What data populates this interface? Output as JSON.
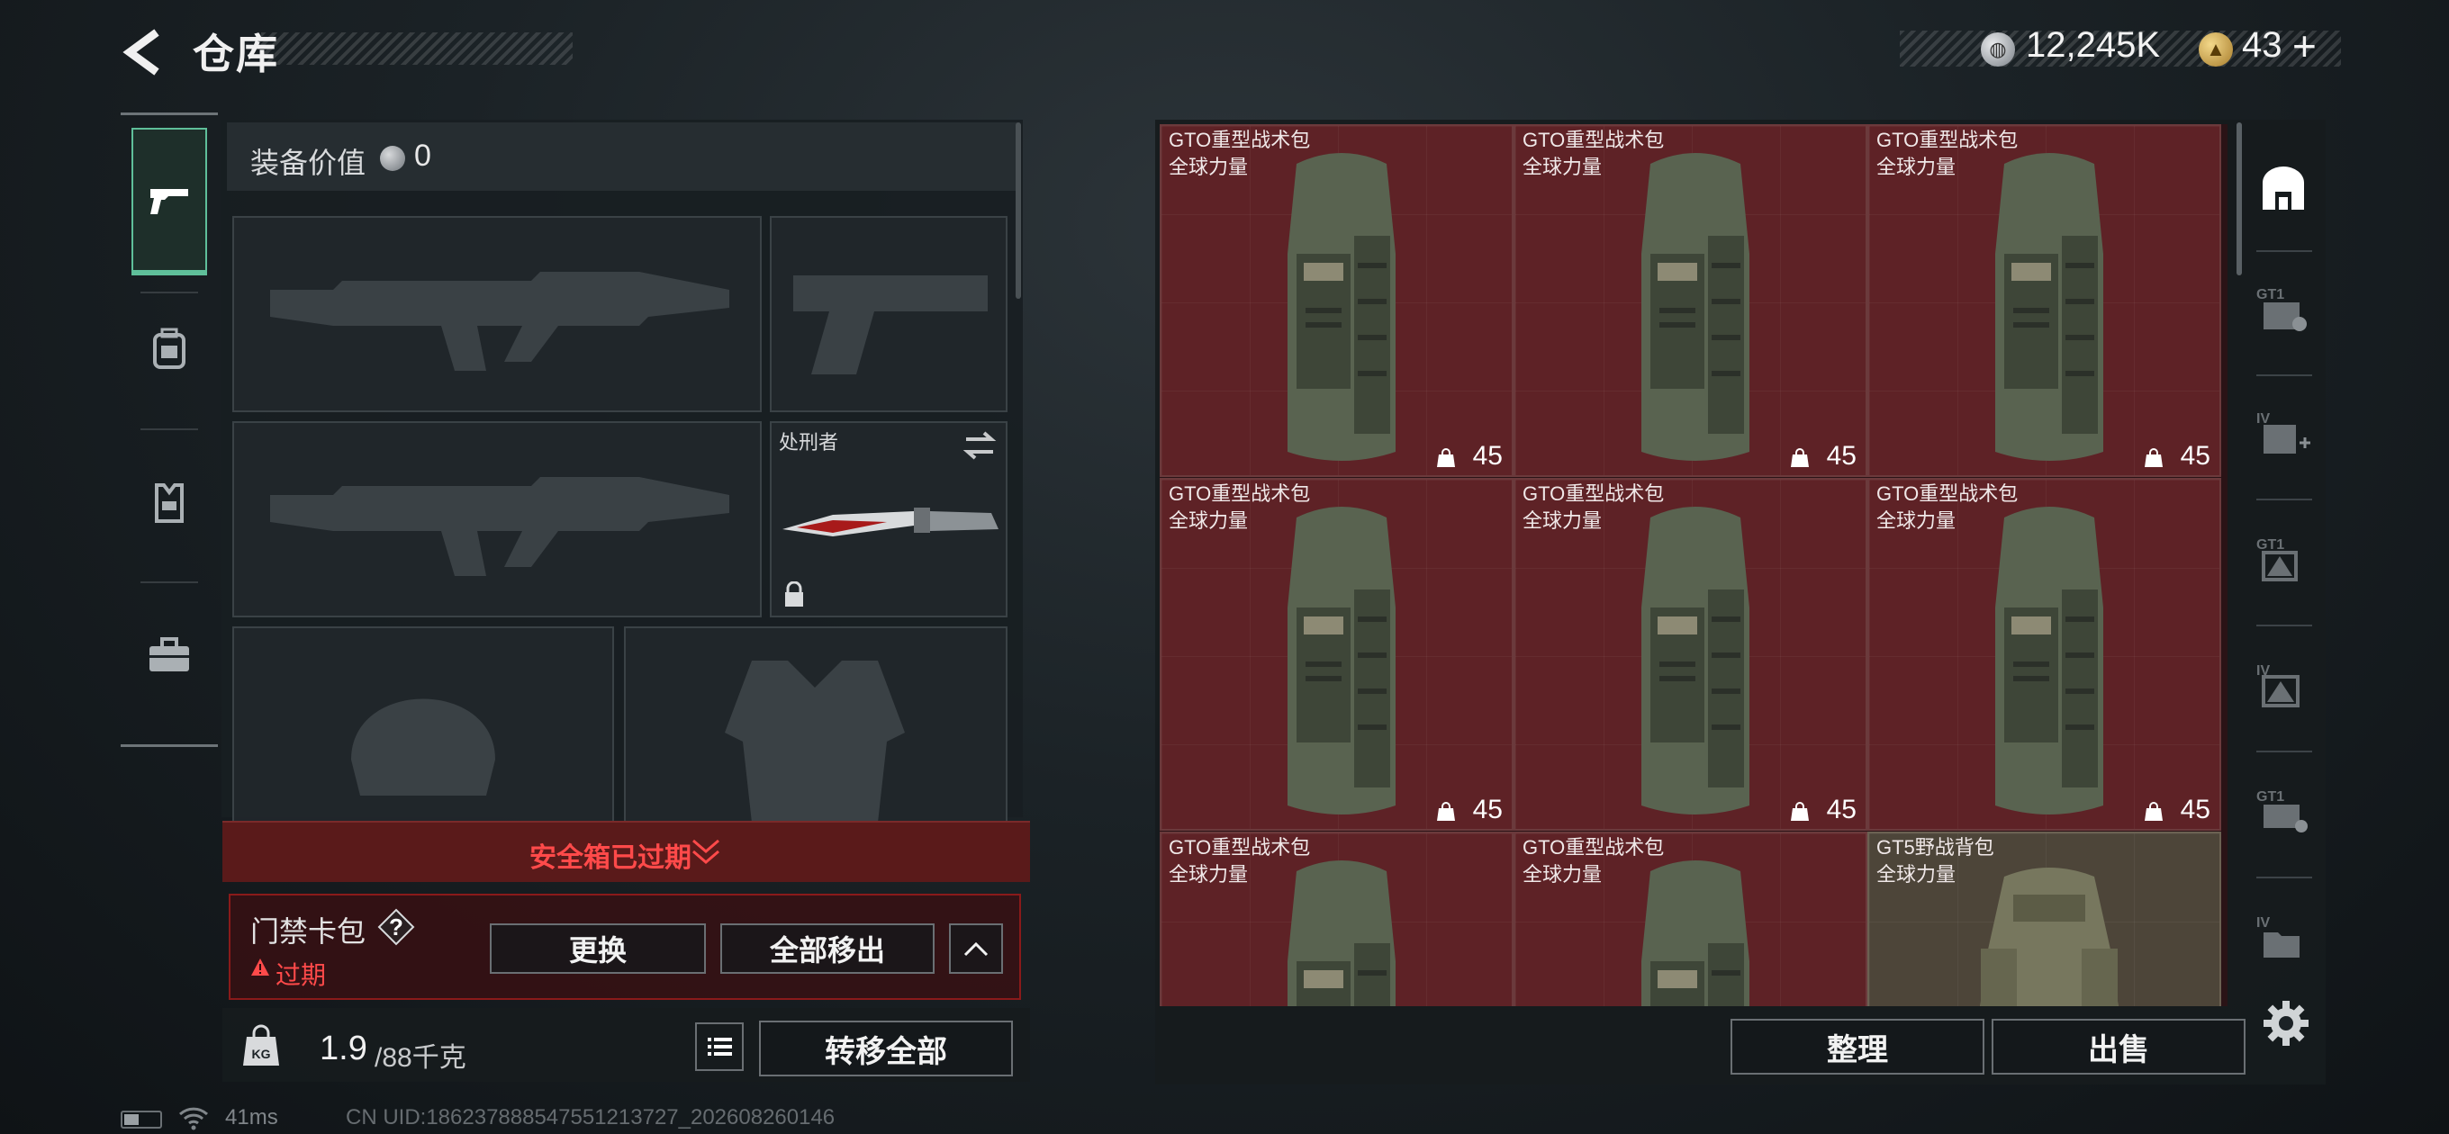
{
  "header": {
    "title": "仓库",
    "currency_primary": "12,245K",
    "currency_secondary": "43",
    "currency_add": "+"
  },
  "left_tabs": [
    {
      "icon": "pistol-icon",
      "active": true
    },
    {
      "icon": "backpack-icon",
      "active": false
    },
    {
      "icon": "vest-icon",
      "active": false
    },
    {
      "icon": "briefcase-icon",
      "active": false
    }
  ],
  "equipment": {
    "value_label": "装备价值",
    "value": "0",
    "melee_name": "处刑者",
    "slots": [
      "primary-weapon-1",
      "secondary-pistol",
      "primary-weapon-2",
      "melee",
      "helmet",
      "armor"
    ]
  },
  "safe_box": {
    "status": "安全箱已过期"
  },
  "keycard": {
    "label": "门禁卡包",
    "help": "?",
    "status": "过期",
    "swap": "更换",
    "move_all": "全部移出"
  },
  "weight": {
    "current": "1.9",
    "max": "/88千克",
    "transfer_all": "转移全部"
  },
  "inventory": {
    "items": [
      {
        "name": "GTO重型战术包",
        "brand": "全球力量",
        "capacity": "45"
      },
      {
        "name": "GTO重型战术包",
        "brand": "全球力量",
        "capacity": "45"
      },
      {
        "name": "GTO重型战术包",
        "brand": "全球力量",
        "capacity": "45"
      },
      {
        "name": "GTO重型战术包",
        "brand": "全球力量",
        "capacity": "45"
      },
      {
        "name": "GTO重型战术包",
        "brand": "全球力量",
        "capacity": "45"
      },
      {
        "name": "GTO重型战术包",
        "brand": "全球力量",
        "capacity": "45"
      },
      {
        "name": "GTO重型战术包",
        "brand": "全球力量",
        "capacity": ""
      },
      {
        "name": "GTO重型战术包",
        "brand": "全球力量",
        "capacity": ""
      },
      {
        "name": "GT5野战背包",
        "brand": "全球力量",
        "capacity": ""
      }
    ],
    "tidy": "整理",
    "sell": "出售"
  },
  "right_tabs": [
    "backpack-filter-icon",
    "gt1-pouch-icon",
    "iv-add-icon",
    "gt1-alert-icon",
    "iv-alert-icon",
    "gt1-box-icon",
    "iv-folder-icon"
  ],
  "status_bar": {
    "ping": "41ms",
    "uid": "CN UID:18623788854755121372​7_202608260146"
  },
  "colors": {
    "accent_green": "#5fbf9a",
    "alert_red": "#ff4a4a",
    "cell_red": "#5e2226"
  }
}
